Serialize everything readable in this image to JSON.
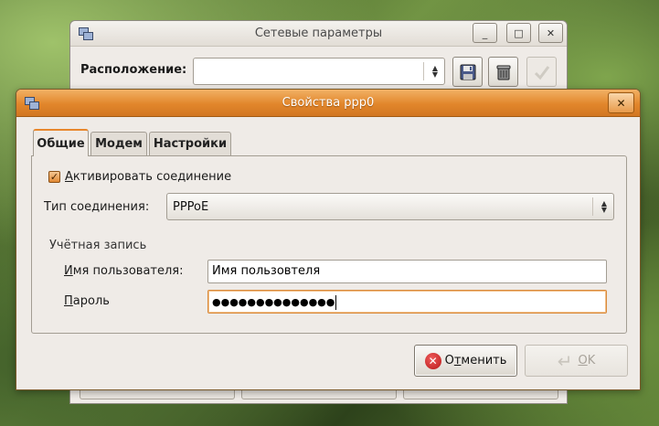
{
  "back_window": {
    "title": "Сетевые параметры",
    "location_label": "Расположение:",
    "location_value": "",
    "minimize_glyph": "_",
    "maximize_glyph": "□",
    "close_glyph": "✕"
  },
  "dialog": {
    "title": "Свойства ppp0",
    "close_glyph": "✕",
    "tabs": [
      {
        "label": "Общие",
        "active": true
      },
      {
        "label": "Модем",
        "active": false
      },
      {
        "label": "Настройки",
        "active": false
      }
    ],
    "activate": {
      "label_first": "А",
      "label_rest": "ктивировать соединение",
      "checked": true
    },
    "connection_type": {
      "label": "Тип соединения:",
      "value": "PPPoE"
    },
    "account": {
      "section_title": "Учётная запись",
      "username_label_first": "И",
      "username_label_rest": "мя пользователя:",
      "username_value": "Имя пользовтеля",
      "password_label_first": "П",
      "password_label_rest": "ароль",
      "password_value": "●●●●●●●●●●●●●●"
    },
    "buttons": {
      "cancel_pre": "О",
      "cancel_underlined": "т",
      "cancel_post": "менить",
      "ok_underlined": "О",
      "ok_post": "K"
    }
  },
  "colors": {
    "title_active": "#e2862b",
    "window_bg": "#efebe7",
    "focus": "#d98a3c"
  }
}
